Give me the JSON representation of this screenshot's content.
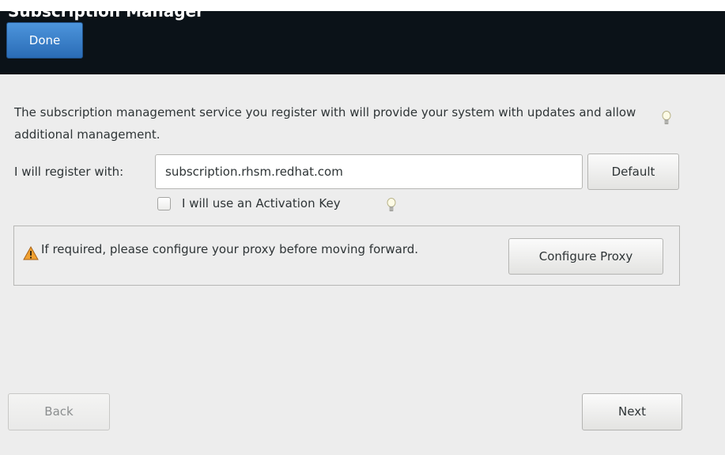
{
  "header": {
    "title": "Subscription Manager",
    "done_label": "Done"
  },
  "info": {
    "text": "The subscription management service you register with will provide your system with updates and allow additional management."
  },
  "register": {
    "label": "I will register with:",
    "server_value": "subscription.rhsm.redhat.com",
    "default_label": "Default"
  },
  "activation_key": {
    "label": "I will use an Activation Key",
    "checked": false
  },
  "proxy": {
    "message": "If required, please configure your proxy before moving forward.",
    "button_label": "Configure Proxy"
  },
  "nav": {
    "back_label": "Back",
    "next_label": "Next"
  },
  "icons": {
    "hint": "lightbulb-icon",
    "warning": "warning-icon"
  },
  "colors": {
    "header_bg": "#0b1218",
    "accent": "#3d82cc",
    "warning": "#f0a030"
  }
}
